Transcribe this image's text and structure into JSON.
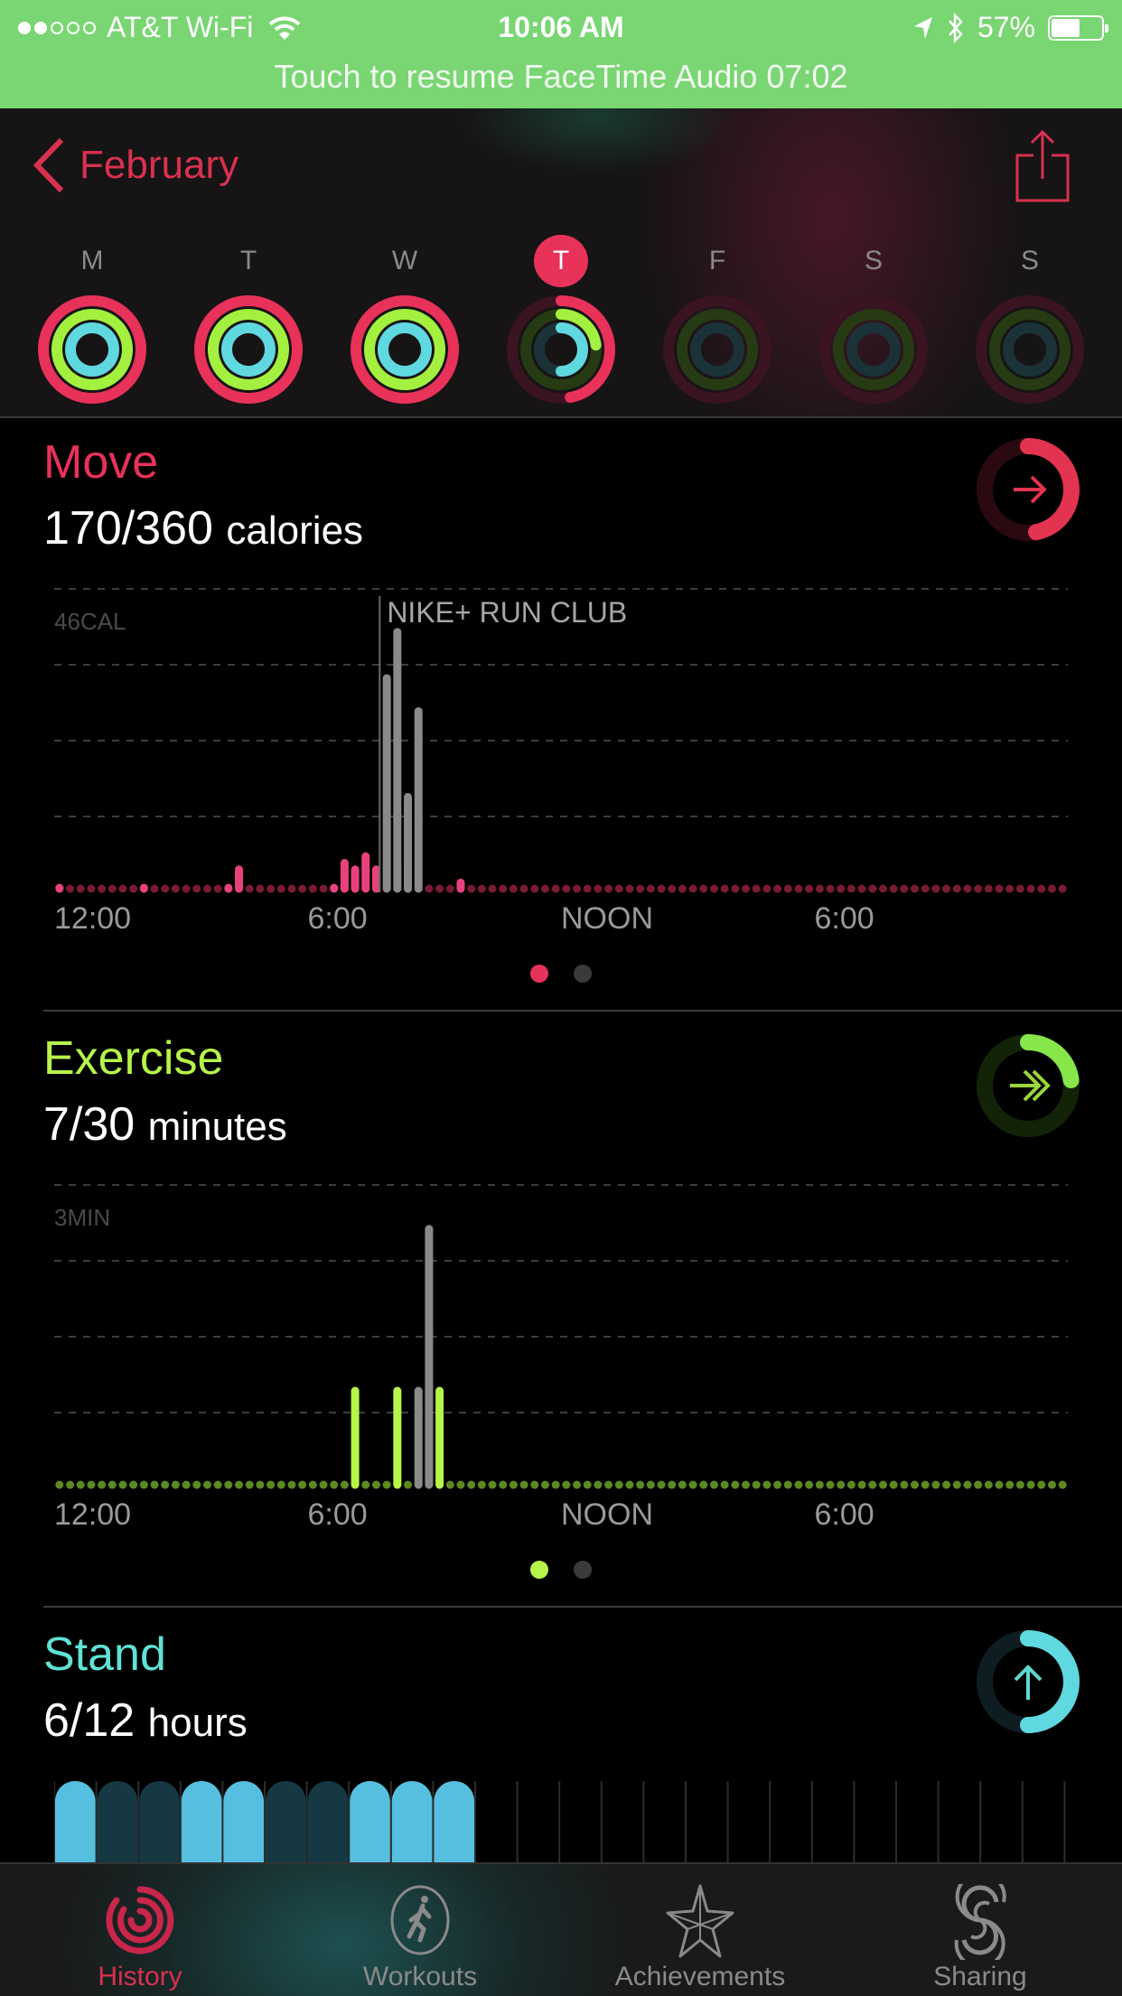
{
  "status_bar": {
    "signal_bars_filled": 2,
    "signal_bars_total": 5,
    "carrier": "AT&T Wi-Fi",
    "time": "10:06 AM",
    "battery_percent": "57%",
    "battery_level": 0.57,
    "banner": "Touch to resume FaceTime Audio 07:02",
    "banner_color": "#79d673"
  },
  "header": {
    "back_label": "February",
    "accent": "#d8314f",
    "days": [
      {
        "label": "M",
        "today": false,
        "move": 1.0,
        "exercise": 1.0,
        "stand": 1.0,
        "future": false
      },
      {
        "label": "T",
        "today": false,
        "move": 1.0,
        "exercise": 1.0,
        "stand": 1.0,
        "future": false
      },
      {
        "label": "W",
        "today": false,
        "move": 1.0,
        "exercise": 1.0,
        "stand": 1.0,
        "future": false
      },
      {
        "label": "T",
        "today": true,
        "move": 0.47,
        "exercise": 0.23,
        "stand": 0.5,
        "future": false
      },
      {
        "label": "F",
        "today": false,
        "move": 0,
        "exercise": 0,
        "stand": 0,
        "future": true
      },
      {
        "label": "S",
        "today": false,
        "move": 0,
        "exercise": 0,
        "stand": 0,
        "future": true
      },
      {
        "label": "S",
        "today": false,
        "move": 0,
        "exercise": 0,
        "stand": 0,
        "future": true
      }
    ]
  },
  "move": {
    "title": "Move",
    "value": "170/360",
    "unit": "calories",
    "progress": 0.47,
    "color": "#e8325a",
    "icon": "arrow-right-icon",
    "page_index": 0,
    "page_count": 2
  },
  "exercise": {
    "title": "Exercise",
    "value": "7/30",
    "unit": "minutes",
    "progress": 0.23,
    "color": "#b6f549",
    "icon": "double-chevron-right-icon",
    "page_index": 0,
    "page_count": 2
  },
  "stand": {
    "title": "Stand",
    "value": "6/12",
    "unit": "hours",
    "progress": 0.5,
    "color": "#5fe3d6",
    "icon": "arrow-up-icon"
  },
  "chart_data": [
    {
      "type": "bar",
      "title": "Move",
      "ylabel": "46CAL",
      "ylim": [
        0,
        46
      ],
      "x_tick_labels": [
        "12:00",
        "6:00",
        "NOON",
        "6:00"
      ],
      "x_unit": "15-minute slots across 24 hours (0-95)",
      "annotation": "NIKE+ RUN CLUB",
      "annotation_slot": 30,
      "grid": true,
      "series": [
        {
          "name": "activity",
          "color": "#e8427e",
          "points": [
            [
              0,
              1
            ],
            [
              8,
              1
            ],
            [
              16,
              1
            ],
            [
              17,
              4
            ],
            [
              26,
              1
            ],
            [
              27,
              5
            ],
            [
              28,
              4
            ],
            [
              29,
              6
            ],
            [
              30,
              4
            ],
            [
              33,
              4
            ],
            [
              38,
              2
            ]
          ]
        },
        {
          "name": "workout",
          "color": "#8a8a8a",
          "points": [
            [
              31,
              33
            ],
            [
              32,
              40
            ],
            [
              33,
              15
            ],
            [
              34,
              28
            ]
          ]
        }
      ]
    },
    {
      "type": "bar",
      "title": "Exercise",
      "ylabel": "3MIN",
      "ylim": [
        0,
        3
      ],
      "x_tick_labels": [
        "12:00",
        "6:00",
        "NOON",
        "6:00"
      ],
      "x_unit": "15-minute slots across 24 hours (0-95)",
      "grid": true,
      "series": [
        {
          "name": "activity",
          "color": "#b6f549",
          "points": [
            [
              28,
              1
            ],
            [
              32,
              1
            ],
            [
              36,
              1
            ]
          ]
        },
        {
          "name": "workout",
          "color": "#8a8a8a",
          "points": [
            [
              34,
              1
            ],
            [
              35,
              2.6
            ]
          ]
        }
      ]
    },
    {
      "type": "bar",
      "title": "Stand",
      "categories_hours": 24,
      "stood_hours": [
        0,
        3,
        4,
        7,
        8,
        9
      ],
      "recorded_hours": 10
    }
  ],
  "tabs": [
    {
      "label": "History",
      "icon": "history-rings-icon",
      "active": true
    },
    {
      "label": "Workouts",
      "icon": "runner-icon",
      "active": false
    },
    {
      "label": "Achievements",
      "icon": "star-icon",
      "active": false
    },
    {
      "label": "Sharing",
      "icon": "sharing-icon",
      "active": false
    }
  ]
}
